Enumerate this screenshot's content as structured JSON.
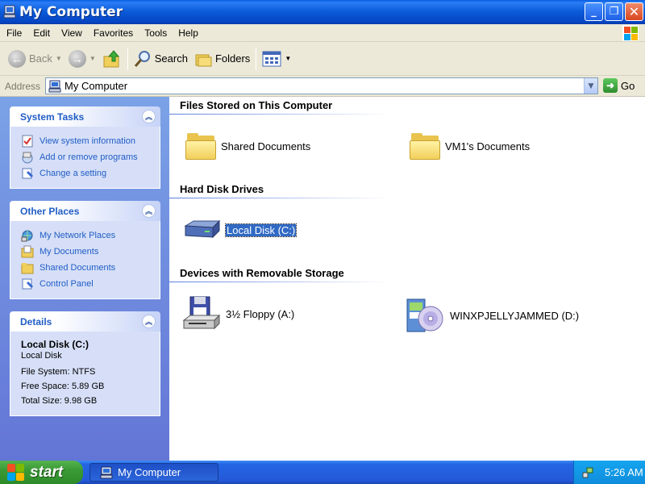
{
  "window": {
    "title": "My Computer"
  },
  "menu": {
    "items": [
      "File",
      "Edit",
      "View",
      "Favorites",
      "Tools",
      "Help"
    ]
  },
  "toolbar": {
    "back_label": "Back",
    "search_label": "Search",
    "folders_label": "Folders"
  },
  "address": {
    "label": "Address",
    "value": "My Computer",
    "go_label": "Go"
  },
  "sidebar": {
    "system_tasks": {
      "title": "System Tasks",
      "items": [
        "View system information",
        "Add or remove programs",
        "Change a setting"
      ]
    },
    "other_places": {
      "title": "Other Places",
      "items": [
        "My Network Places",
        "My Documents",
        "Shared Documents",
        "Control Panel"
      ]
    },
    "details": {
      "title": "Details",
      "name": "Local Disk (C:)",
      "type": "Local Disk",
      "file_system": "File System: NTFS",
      "free_space": "Free Space: 5.89 GB",
      "total_size": "Total Size: 9.98 GB"
    }
  },
  "content": {
    "files_group": {
      "title": "Files Stored on This Computer",
      "items": [
        "Shared Documents",
        "VM1's Documents"
      ]
    },
    "disks_group": {
      "title": "Hard Disk Drives",
      "items": [
        "Local Disk (C:)"
      ]
    },
    "removable_group": {
      "title": "Devices with Removable Storage",
      "items": [
        "3½ Floppy (A:)",
        "WINXPJELLYJAMMED (D:)"
      ]
    }
  },
  "taskbar": {
    "start_label": "start",
    "task_label": "My Computer",
    "clock": "5:26 AM"
  },
  "colors": {
    "titlebar": "#0a5ad8",
    "link": "#215dc6",
    "selection": "#316ac5",
    "start": "#3a9a35"
  }
}
